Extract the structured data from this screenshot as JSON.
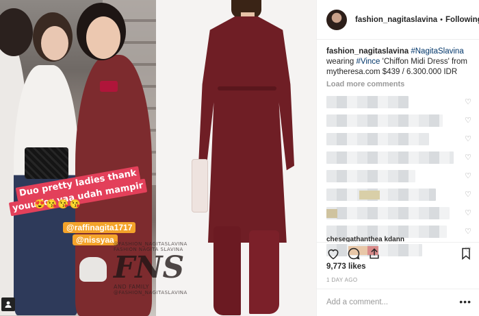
{
  "story": {
    "text_line1": "Duo pretty ladies thank",
    "text_line2": "youu for yaa udah mampir",
    "emojis": "😍😘😘😘",
    "mention1": "@raffinagita1717",
    "mention2": "@nissyaa"
  },
  "watermark": {
    "line1": "@FASHION_NAGITASLAVINA",
    "line2": "FASHION NAGITA SLAVINA",
    "logo": "FNS",
    "line3": "AND FAMILY",
    "line4": "@FASHION_NAGITASLAVINA"
  },
  "header": {
    "username": "fashion_nagitaslavina",
    "separator": "•",
    "follow_status": "Following"
  },
  "caption": {
    "username": "fashion_nagitaslavina",
    "tag1": "#NagitaSlavina",
    "text1": "wearing",
    "tag2": "#Vince",
    "text2": "'Chiffon Midi Dress' from mytheresa.com $439 / 6.300.000 IDR"
  },
  "comments": {
    "load_more": "Load more comments",
    "partial_username": "chesegathanthea kdann"
  },
  "post": {
    "likes": "9,773 likes",
    "time_ago": "1 DAY AGO",
    "comment_placeholder": "Add a comment...",
    "more_label": "•••"
  },
  "icons": [
    "heart-icon",
    "comment-icon",
    "share-icon",
    "bookmark-icon",
    "ig-corner-icon"
  ]
}
